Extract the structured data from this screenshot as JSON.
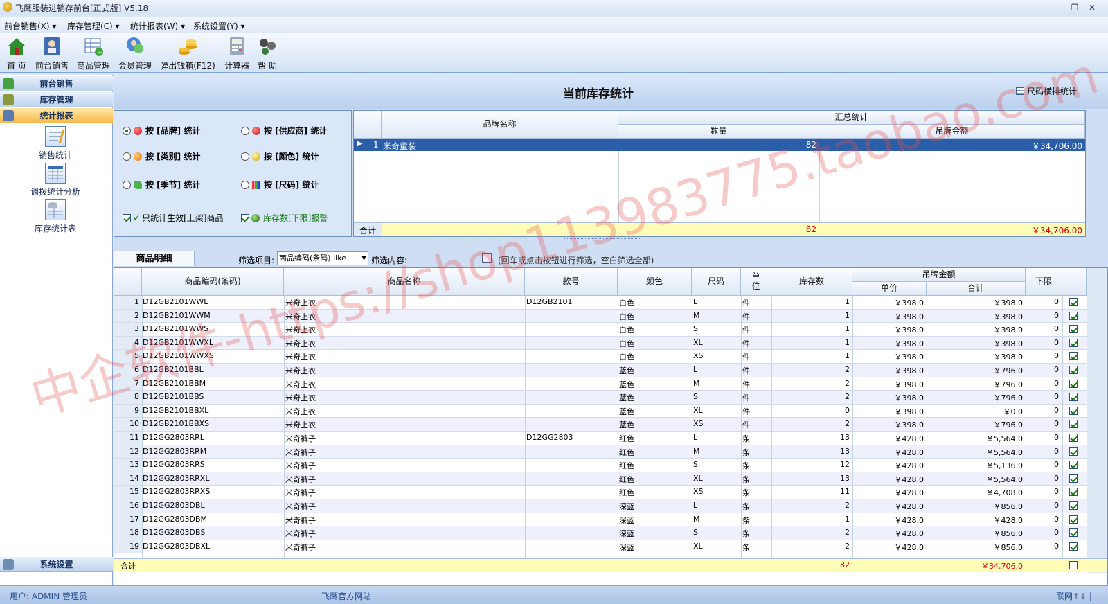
{
  "window": {
    "title": "飞鹰服装进销存前台[正式版] V5.18",
    "min_label": "–",
    "max_label": "❐",
    "close_label": "✕"
  },
  "menu": [
    "前台销售(X) ▾",
    "库存管理(C) ▾",
    "统计报表(W) ▾",
    "系统设置(Y) ▾"
  ],
  "toolbar": [
    {
      "label": "首 页",
      "icon": "home-icon"
    },
    {
      "label": "前台销售",
      "icon": "sales-icon"
    },
    {
      "label": "商品管理",
      "icon": "goods-icon"
    },
    {
      "label": "会员管理",
      "icon": "member-icon"
    },
    {
      "label": "弹出钱箱(F12)",
      "icon": "cash-drawer-icon"
    },
    {
      "label": "计算器",
      "icon": "calculator-icon"
    },
    {
      "label": "帮 助",
      "icon": "help-icon"
    }
  ],
  "sidebar": {
    "nav": [
      "前台销售",
      "库存管理",
      "统计报表"
    ],
    "items": [
      "销售统计",
      "调拨统计分析",
      "库存统计表"
    ],
    "bottom_nav": "系统设置"
  },
  "header": {
    "title": "当前库存统计",
    "size_button": "尺码横排统计"
  },
  "options": {
    "by_brand": "按 [品牌] 统计",
    "by_supplier": "按 [供应商] 统计",
    "by_category": "按 [类别] 统计",
    "by_color": "按 [颜色] 统计",
    "by_season": "按 [季节] 统计",
    "by_size": "按 [尺码] 统计",
    "only_active": "只统计生效[上架]商品",
    "stock_alarm": "库存数[下限]报警"
  },
  "summary": {
    "col_brand": "品牌名称",
    "group": "汇总统计",
    "col_qty": "数量",
    "col_amount": "吊牌金额",
    "rows": [
      {
        "no": "1",
        "brand": "米奇童装",
        "qty": "82",
        "amount": "￥34,706.00"
      }
    ],
    "total_label": "合计",
    "total_qty": "82",
    "total_amount": "￥34,706.00"
  },
  "detail": {
    "tab": "商品明细",
    "filter_label": "筛选项目:",
    "filter_value": "商品编码(条码) like",
    "content_label": "筛选内容:",
    "hint": "(回车或点击按钮进行筛选，空白筛选全部)",
    "headers": {
      "code": "商品编码(条码)",
      "name": "商品名称",
      "style": "款号",
      "color": "颜色",
      "size": "尺码",
      "unit": "单\n位",
      "stock": "库存数",
      "price_group": "吊牌金额",
      "unit_price": "单价",
      "total": "合计",
      "limit": "下限"
    },
    "rows": [
      {
        "no": "1",
        "code": "D12GB2101WWL",
        "name": "米奇上衣",
        "style": "D12GB2101",
        "color": "白色",
        "size": "L",
        "unit": "件",
        "stock": "1",
        "price": "￥398.0",
        "total": "￥398.0",
        "limit": "0"
      },
      {
        "no": "2",
        "code": "D12GB2101WWM",
        "name": "米奇上衣",
        "style": "",
        "color": "白色",
        "size": "M",
        "unit": "件",
        "stock": "1",
        "price": "￥398.0",
        "total": "￥398.0",
        "limit": "0"
      },
      {
        "no": "3",
        "code": "D12GB2101WWS",
        "name": "米奇上衣",
        "style": "",
        "color": "白色",
        "size": "S",
        "unit": "件",
        "stock": "1",
        "price": "￥398.0",
        "total": "￥398.0",
        "limit": "0"
      },
      {
        "no": "4",
        "code": "D12GB2101WWXL",
        "name": "米奇上衣",
        "style": "",
        "color": "白色",
        "size": "XL",
        "unit": "件",
        "stock": "1",
        "price": "￥398.0",
        "total": "￥398.0",
        "limit": "0"
      },
      {
        "no": "5",
        "code": "D12GB2101WWXS",
        "name": "米奇上衣",
        "style": "",
        "color": "白色",
        "size": "XS",
        "unit": "件",
        "stock": "1",
        "price": "￥398.0",
        "total": "￥398.0",
        "limit": "0"
      },
      {
        "no": "6",
        "code": "D12GB2101BBL",
        "name": "米奇上衣",
        "style": "",
        "color": "蓝色",
        "size": "L",
        "unit": "件",
        "stock": "2",
        "price": "￥398.0",
        "total": "￥796.0",
        "limit": "0"
      },
      {
        "no": "7",
        "code": "D12GB2101BBM",
        "name": "米奇上衣",
        "style": "",
        "color": "蓝色",
        "size": "M",
        "unit": "件",
        "stock": "2",
        "price": "￥398.0",
        "total": "￥796.0",
        "limit": "0"
      },
      {
        "no": "8",
        "code": "D12GB2101BBS",
        "name": "米奇上衣",
        "style": "",
        "color": "蓝色",
        "size": "S",
        "unit": "件",
        "stock": "2",
        "price": "￥398.0",
        "total": "￥796.0",
        "limit": "0"
      },
      {
        "no": "9",
        "code": "D12GB2101BBXL",
        "name": "米奇上衣",
        "style": "",
        "color": "蓝色",
        "size": "XL",
        "unit": "件",
        "stock": "0",
        "price": "￥398.0",
        "total": "￥0.0",
        "limit": "0"
      },
      {
        "no": "10",
        "code": "D12GB2101BBXS",
        "name": "米奇上衣",
        "style": "",
        "color": "蓝色",
        "size": "XS",
        "unit": "件",
        "stock": "2",
        "price": "￥398.0",
        "total": "￥796.0",
        "limit": "0"
      },
      {
        "no": "11",
        "code": "D12GG2803RRL",
        "name": "米奇裤子",
        "style": "D12GG2803",
        "color": "红色",
        "size": "L",
        "unit": "条",
        "stock": "13",
        "price": "￥428.0",
        "total": "￥5,564.0",
        "limit": "0"
      },
      {
        "no": "12",
        "code": "D12GG2803RRM",
        "name": "米奇裤子",
        "style": "",
        "color": "红色",
        "size": "M",
        "unit": "条",
        "stock": "13",
        "price": "￥428.0",
        "total": "￥5,564.0",
        "limit": "0"
      },
      {
        "no": "13",
        "code": "D12GG2803RRS",
        "name": "米奇裤子",
        "style": "",
        "color": "红色",
        "size": "S",
        "unit": "条",
        "stock": "12",
        "price": "￥428.0",
        "total": "￥5,136.0",
        "limit": "0"
      },
      {
        "no": "14",
        "code": "D12GG2803RRXL",
        "name": "米奇裤子",
        "style": "",
        "color": "红色",
        "size": "XL",
        "unit": "条",
        "stock": "13",
        "price": "￥428.0",
        "total": "￥5,564.0",
        "limit": "0"
      },
      {
        "no": "15",
        "code": "D12GG2803RRXS",
        "name": "米奇裤子",
        "style": "",
        "color": "红色",
        "size": "XS",
        "unit": "条",
        "stock": "11",
        "price": "￥428.0",
        "total": "￥4,708.0",
        "limit": "0"
      },
      {
        "no": "16",
        "code": "D12GG2803DBL",
        "name": "米奇裤子",
        "style": "",
        "color": "深蓝",
        "size": "L",
        "unit": "条",
        "stock": "2",
        "price": "￥428.0",
        "total": "￥856.0",
        "limit": "0"
      },
      {
        "no": "17",
        "code": "D12GG2803DBM",
        "name": "米奇裤子",
        "style": "",
        "color": "深蓝",
        "size": "M",
        "unit": "条",
        "stock": "1",
        "price": "￥428.0",
        "total": "￥428.0",
        "limit": "0"
      },
      {
        "no": "18",
        "code": "D12GG2803DBS",
        "name": "米奇裤子",
        "style": "",
        "color": "深蓝",
        "size": "S",
        "unit": "条",
        "stock": "2",
        "price": "￥428.0",
        "total": "￥856.0",
        "limit": "0"
      },
      {
        "no": "19",
        "code": "D12GG2803DBXL",
        "name": "米奇裤子",
        "style": "",
        "color": "深蓝",
        "size": "XL",
        "unit": "条",
        "stock": "2",
        "price": "￥428.0",
        "total": "￥856.0",
        "limit": "0"
      }
    ],
    "total_label": "合计",
    "total_stock": "82",
    "total_amount": "￥34,706.0"
  },
  "status": {
    "user": "用户: ADMIN 管理员",
    "site": "飞鹰官方网站",
    "net": "联网↑↓ |"
  },
  "watermark": "中企软件-https://shop113983775.taobao.com"
}
